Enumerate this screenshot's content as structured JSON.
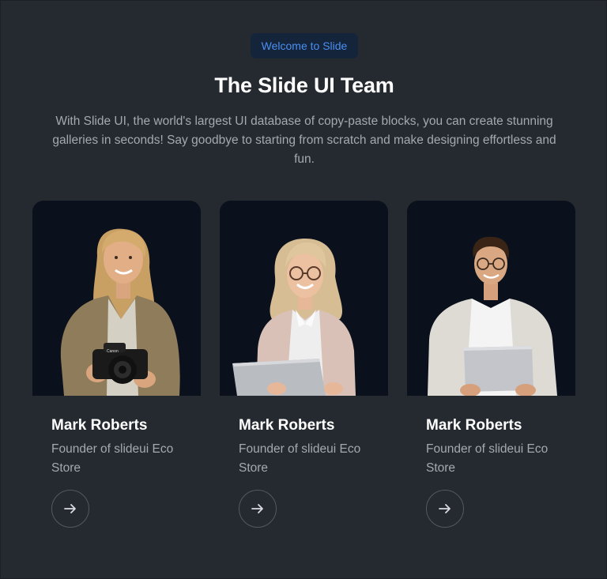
{
  "header": {
    "badge": "Welcome to Slide",
    "title": "The Slide UI Team",
    "description": "With Slide UI, the world's largest UI database of copy-paste blocks, you can create stunning galleries in seconds! Say goodbye to starting from scratch and make designing effortless and fun."
  },
  "team": [
    {
      "name": "Mark Roberts",
      "role": "Founder of slideui Eco Store",
      "button_icon": "arrow-right-icon"
    },
    {
      "name": "Mark Roberts",
      "role": "Founder of slideui Eco Store",
      "button_icon": "arrow-right-icon"
    },
    {
      "name": "Mark Roberts",
      "role": "Founder of slideui Eco Store",
      "button_icon": "arrow-right-icon"
    }
  ],
  "colors": {
    "background": "#252a31",
    "card_photo_bg": "#0b111c",
    "badge_bg": "#14243b",
    "badge_text": "#4b8ff0",
    "heading": "#ffffff",
    "body_text": "#a4a9b1"
  }
}
